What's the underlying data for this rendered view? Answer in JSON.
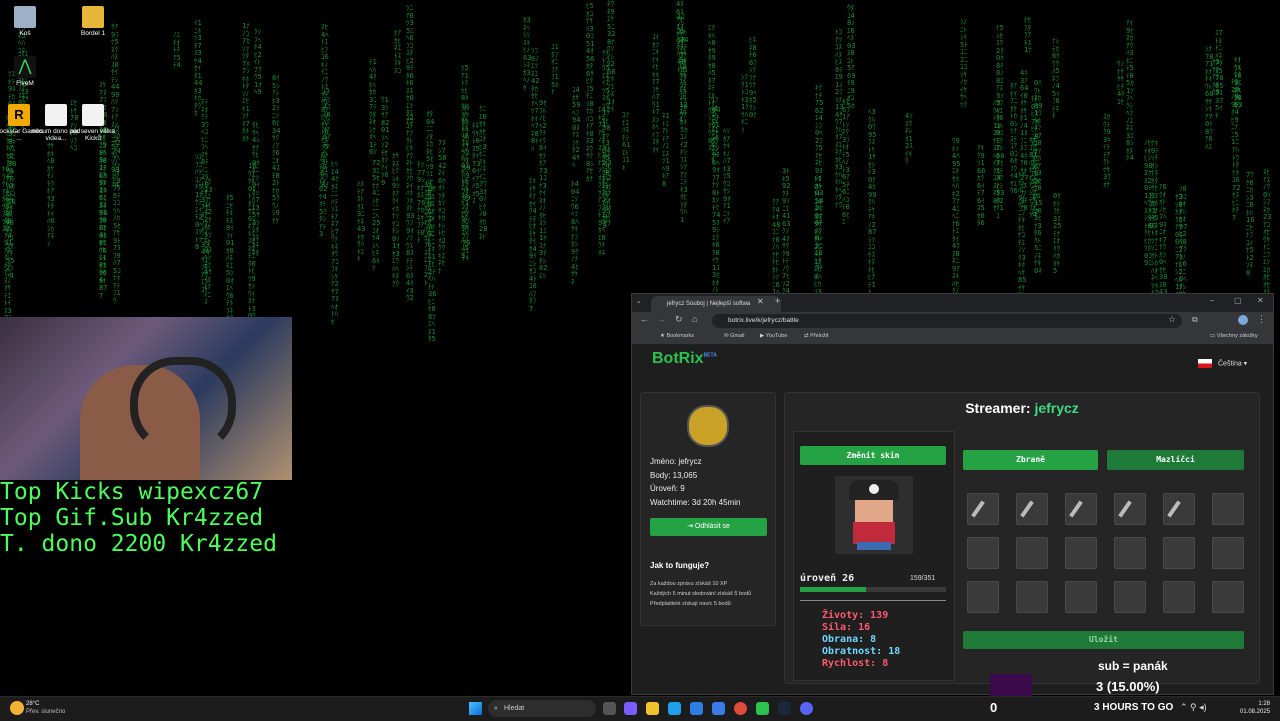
{
  "desktop": {
    "icons": [
      {
        "label": "Koš"
      },
      {
        "label": "Bordel 1"
      },
      {
        "label": "FiveM"
      },
      {
        "label": "Rockstar Games ..."
      },
      {
        "label": "něcum dono pod videa..."
      },
      {
        "label": "six seven válka Kicků"
      }
    ]
  },
  "overlay": {
    "line1": "Top Kicks wipexcz67",
    "line2": "Top Gif.Sub Kr4zzed",
    "line3": "T. dono 2200 Kr4zzed",
    "sub_text": "sub = panák",
    "percent_text": "3 (15.00%)",
    "countdown": "3 HOURS TO GO",
    "counter": "0"
  },
  "browser": {
    "tab_title": "jefrycz Souboj | Nejlepší softwa",
    "url": "botrix.live/k/jefrycz/battle",
    "bookmarks": [
      "Bookmarks",
      "Gmail",
      "YouTube",
      "Přeložit"
    ],
    "all_bookmarks": "Všechny záložky"
  },
  "botrix": {
    "logo": "BotRix",
    "beta": "BETA",
    "language": "Čeština",
    "profile": {
      "name": "Jméno: jefrycz",
      "points": "Body: 13,065",
      "level": "Úroveň: 9",
      "watchtime": "Watchtime: 3d 20h 45min",
      "logout": "Odhlásit se"
    },
    "howto": {
      "title": "Jak to funguje?",
      "line1": "Za každou zprávu získáš 10 XP",
      "line2": "Každých 5 minut sledování získáš 5 bodů",
      "line3": "Předplatitelé získají navíc 5 bodů"
    },
    "streamer_label": "Streamer:",
    "streamer_name": "jefrycz",
    "change_skin": "Změnit skin",
    "level_label": "úroveň 26",
    "xp": "159/351",
    "xp_fraction": 0.453,
    "stats": {
      "lives": "Životy: 139",
      "strength": "Síla: 16",
      "defense": "Obrana: 8",
      "agility": "Obratnost: 18",
      "speed": "Rychlost: 8"
    },
    "tabs": {
      "weapons": "Zbraně",
      "pets": "Mazlíčci"
    },
    "save": "Uložit"
  },
  "taskbar": {
    "weather_temp": "28°C",
    "weather_desc": "Přev. slunečno",
    "search": "Hledat",
    "time": "1:28",
    "date": "01.08.2025"
  },
  "colors": {
    "accent_green": "#25a244",
    "streamer_green": "#3ddc84",
    "stat_red": "#ff5a6e",
    "stat_cyan": "#6fd6ff"
  }
}
